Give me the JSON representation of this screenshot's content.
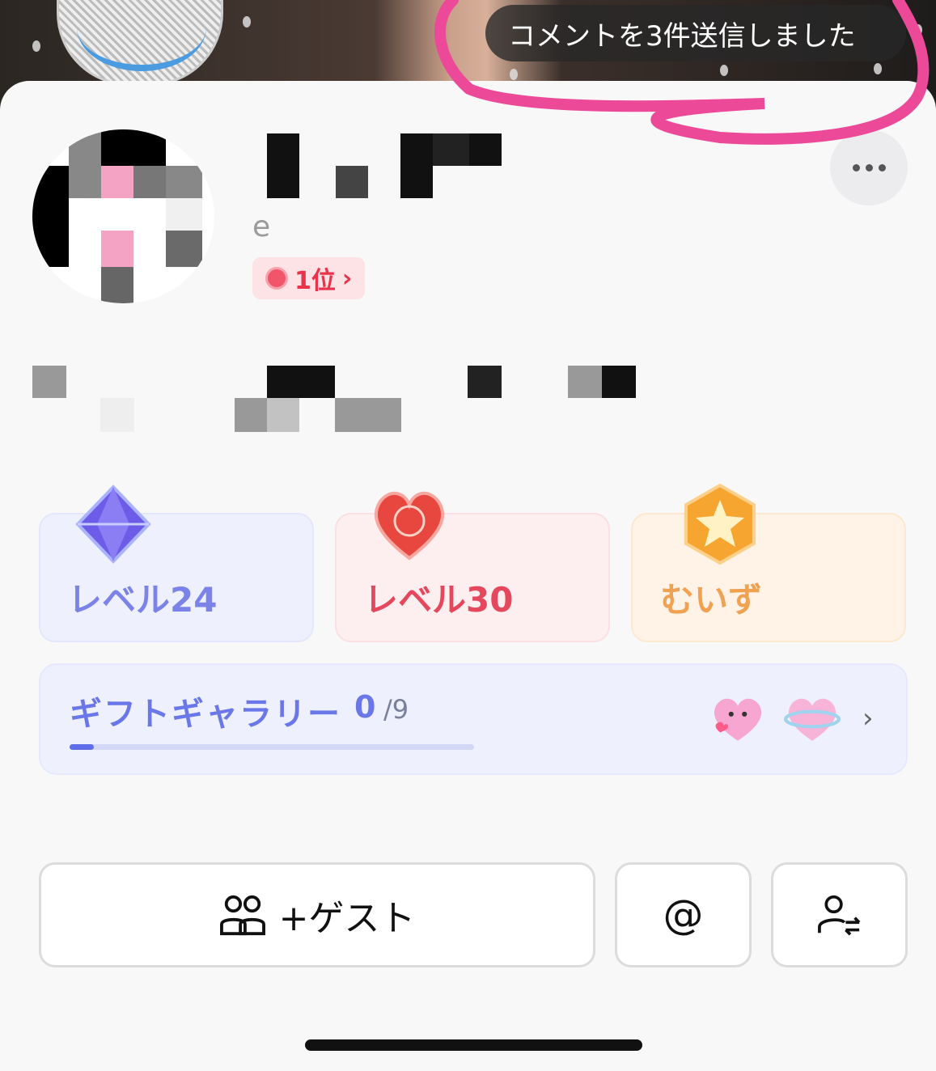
{
  "toast": {
    "text": "コメントを3件送信しました"
  },
  "profile": {
    "handle_visible": "e",
    "rank_badge": {
      "label": "1位",
      "chevron": "›"
    },
    "more_icon": "more-horizontal-icon"
  },
  "cards": [
    {
      "label": "レベル24",
      "icon": "diamond-icon",
      "color": "#7c83e8",
      "bg": "#eef0fd"
    },
    {
      "label": "レベル30",
      "icon": "heart-icon",
      "color": "#e5485c",
      "bg": "#fdeef0"
    },
    {
      "label": "むいず",
      "icon": "star-badge-icon",
      "color": "#f0a253",
      "bg": "#fef3e6"
    }
  ],
  "gift_gallery": {
    "title": "ギフトギャラリー",
    "count": "0",
    "total": "/9",
    "progress": 0.06,
    "chevron": "›"
  },
  "actions": {
    "guest_label": "+ゲスト",
    "at_label": "@"
  },
  "colors": {
    "accent": "#6a77e8",
    "rank": "#e8334a",
    "toast_bg": "#282828"
  }
}
